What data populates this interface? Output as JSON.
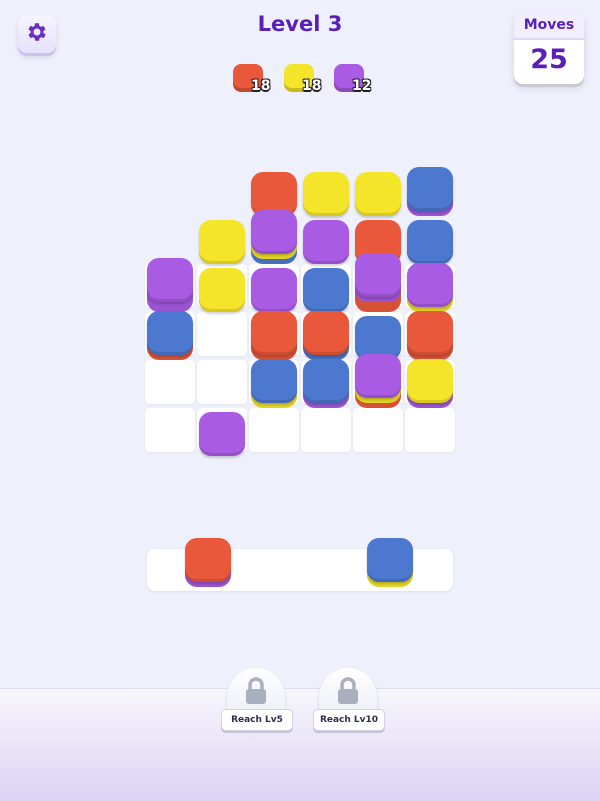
{
  "header": {
    "level_title": "Level 3",
    "moves_label": "Moves",
    "moves_value": "25",
    "settings_icon": "gear-icon"
  },
  "colors": {
    "red": "#e9583b",
    "yellow": "#f5e52a",
    "purple": "#a95be3",
    "blue": "#4d78d0",
    "accent": "#5a1fb8"
  },
  "targets": [
    {
      "color": "red",
      "count": "18"
    },
    {
      "color": "yellow",
      "count": "18"
    },
    {
      "color": "purple",
      "count": "12"
    }
  ],
  "board": {
    "columns": 6,
    "rows": 6,
    "cells": [
      [
        2,
        0
      ],
      [
        2,
        1
      ],
      [
        2,
        2
      ],
      [
        2,
        3
      ],
      [
        2,
        4
      ],
      [
        2,
        5
      ],
      [
        3,
        0
      ],
      [
        3,
        1
      ],
      [
        3,
        2
      ],
      [
        3,
        3
      ],
      [
        3,
        4
      ],
      [
        3,
        5
      ],
      [
        4,
        0
      ],
      [
        4,
        1
      ],
      [
        4,
        2
      ],
      [
        4,
        3
      ],
      [
        4,
        4
      ],
      [
        4,
        5
      ],
      [
        5,
        0
      ],
      [
        5,
        1
      ],
      [
        5,
        2
      ],
      [
        5,
        3
      ],
      [
        5,
        4
      ],
      [
        5,
        5
      ]
    ],
    "stacks": [
      {
        "row": 2,
        "col": 0,
        "layers": [
          "purple",
          "purple",
          "purple"
        ]
      },
      {
        "row": 3,
        "col": 0,
        "layers": [
          "red",
          "blue"
        ]
      },
      {
        "row": 1,
        "col": 1,
        "layers": [
          "yellow"
        ]
      },
      {
        "row": 2,
        "col": 1,
        "layers": [
          "yellow"
        ]
      },
      {
        "row": 5,
        "col": 1,
        "layers": [
          "purple"
        ]
      },
      {
        "row": 0,
        "col": 2,
        "layers": [
          "red"
        ]
      },
      {
        "row": 1,
        "col": 2,
        "layers": [
          "blue",
          "yellow",
          "purple"
        ]
      },
      {
        "row": 2,
        "col": 2,
        "layers": [
          "purple"
        ]
      },
      {
        "row": 3,
        "col": 2,
        "layers": [
          "red",
          "red"
        ]
      },
      {
        "row": 4,
        "col": 2,
        "layers": [
          "yellow",
          "blue"
        ]
      },
      {
        "row": 0,
        "col": 3,
        "layers": [
          "yellow"
        ]
      },
      {
        "row": 1,
        "col": 3,
        "layers": [
          "purple"
        ]
      },
      {
        "row": 2,
        "col": 3,
        "layers": [
          "blue"
        ]
      },
      {
        "row": 3,
        "col": 3,
        "layers": [
          "blue",
          "red"
        ]
      },
      {
        "row": 4,
        "col": 3,
        "layers": [
          "purple",
          "blue"
        ]
      },
      {
        "row": 0,
        "col": 4,
        "layers": [
          "yellow"
        ]
      },
      {
        "row": 1,
        "col": 4,
        "layers": [
          "red"
        ]
      },
      {
        "row": 2,
        "col": 4,
        "layers": [
          "red",
          "red",
          "purple",
          "purple"
        ]
      },
      {
        "row": 3,
        "col": 4,
        "layers": [
          "blue"
        ]
      },
      {
        "row": 4,
        "col": 4,
        "layers": [
          "red",
          "yellow",
          "purple"
        ]
      },
      {
        "row": 0,
        "col": 5,
        "layers": [
          "purple",
          "blue"
        ]
      },
      {
        "row": 1,
        "col": 5,
        "layers": [
          "blue"
        ]
      },
      {
        "row": 2,
        "col": 5,
        "layers": [
          "yellow",
          "purple"
        ]
      },
      {
        "row": 3,
        "col": 5,
        "layers": [
          "red",
          "red"
        ]
      },
      {
        "row": 4,
        "col": 5,
        "layers": [
          "purple",
          "yellow"
        ]
      }
    ]
  },
  "tray": {
    "stacks": [
      {
        "slot": 0,
        "layers": [
          "purple",
          "red"
        ]
      },
      {
        "slot": 1,
        "layers": [
          "yellow",
          "blue"
        ]
      }
    ]
  },
  "locked_slots": [
    {
      "label": "Reach Lv5",
      "icon": "lock-icon"
    },
    {
      "label": "Reach Lv10",
      "icon": "lock-icon"
    }
  ]
}
